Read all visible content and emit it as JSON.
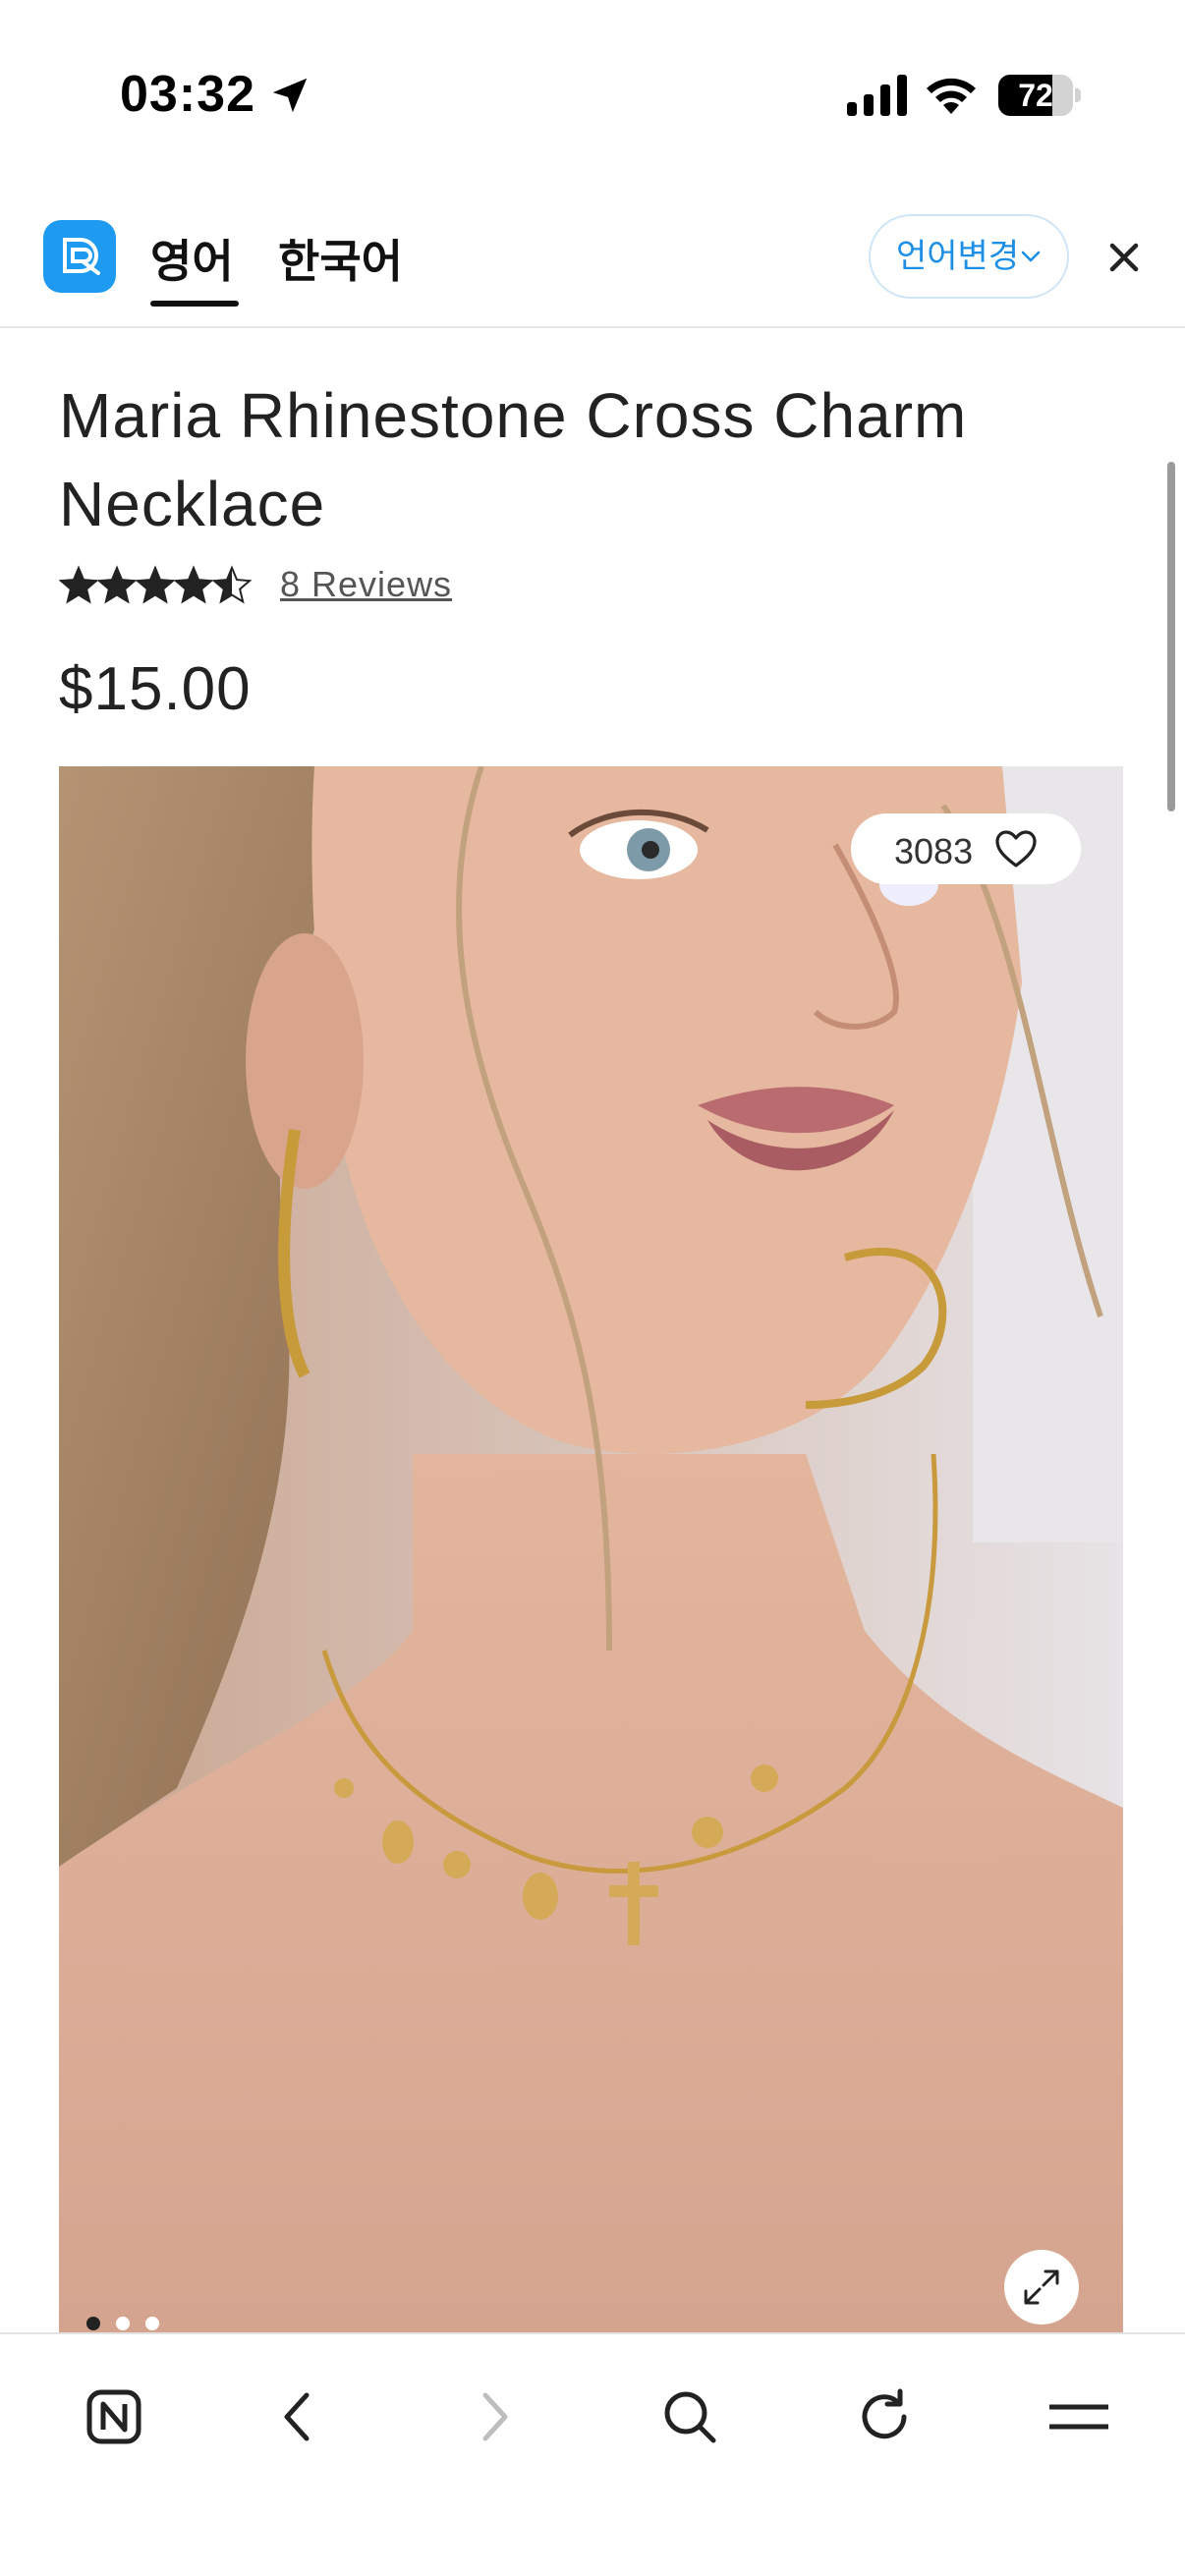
{
  "status_bar": {
    "time": "03:32",
    "battery_level": "72",
    "battery_fraction": 0.72
  },
  "translate_bar": {
    "tabs": [
      {
        "label": "영어",
        "selected": true
      },
      {
        "label": "한국어",
        "selected": false
      }
    ],
    "language_button": "언어변경"
  },
  "product": {
    "title": "Maria Rhinestone Cross Charm Necklace",
    "rating": 4.5,
    "rating_max": 5,
    "reviews_link": "8 Reviews",
    "price": "$15.00",
    "wishlist_count": "3083",
    "image_count": 3,
    "image_index": 1
  },
  "toolbar": {
    "items": [
      "naver-home",
      "back",
      "forward",
      "search",
      "reload",
      "menu"
    ]
  },
  "colors": {
    "accent_blue": "#1e9bf0",
    "text_dark": "#222222"
  }
}
